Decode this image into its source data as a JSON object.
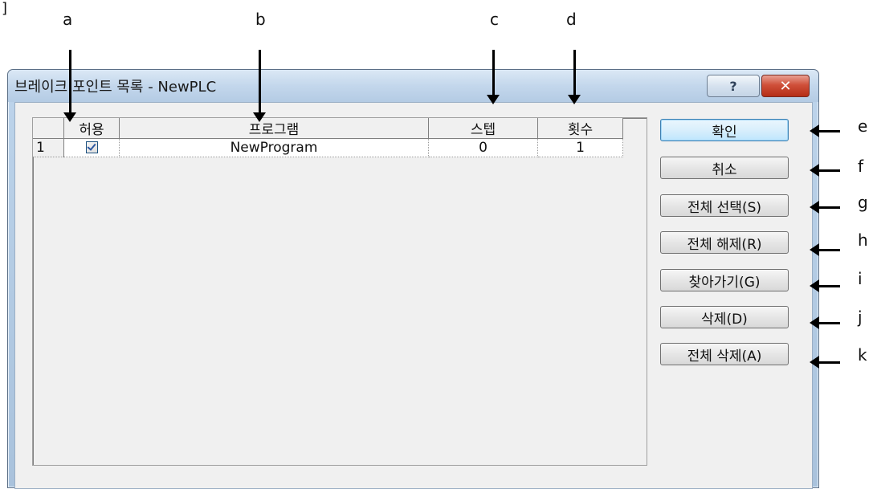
{
  "callouts": {
    "top": [
      "a",
      "b",
      "c",
      "d"
    ],
    "right": [
      "e",
      "f",
      "g",
      "h",
      "i",
      "j",
      "k"
    ],
    "corner": "]"
  },
  "window": {
    "title": "브레이크 포인트 목록 - NewPLC",
    "help_label": "?",
    "close_label": "✕"
  },
  "grid": {
    "columns": [
      "",
      "허용",
      "프로그램",
      "스텝",
      "횟수"
    ],
    "rows": [
      {
        "index": "1",
        "allowed": true,
        "program": "NewProgram",
        "step": "0",
        "count": "1"
      }
    ]
  },
  "buttons": {
    "ok": "확인",
    "cancel": "취소",
    "select_all": "전체 선택(S)",
    "deselect_all": "전체 해제(R)",
    "goto": "찾아가기(G)",
    "delete": "삭제(D)",
    "delete_all": "전체 삭제(A)"
  },
  "colors": {
    "close_button": "#c2402b",
    "title_bar": "#bcd3ea",
    "default_button_border": "#3c7fb1"
  }
}
